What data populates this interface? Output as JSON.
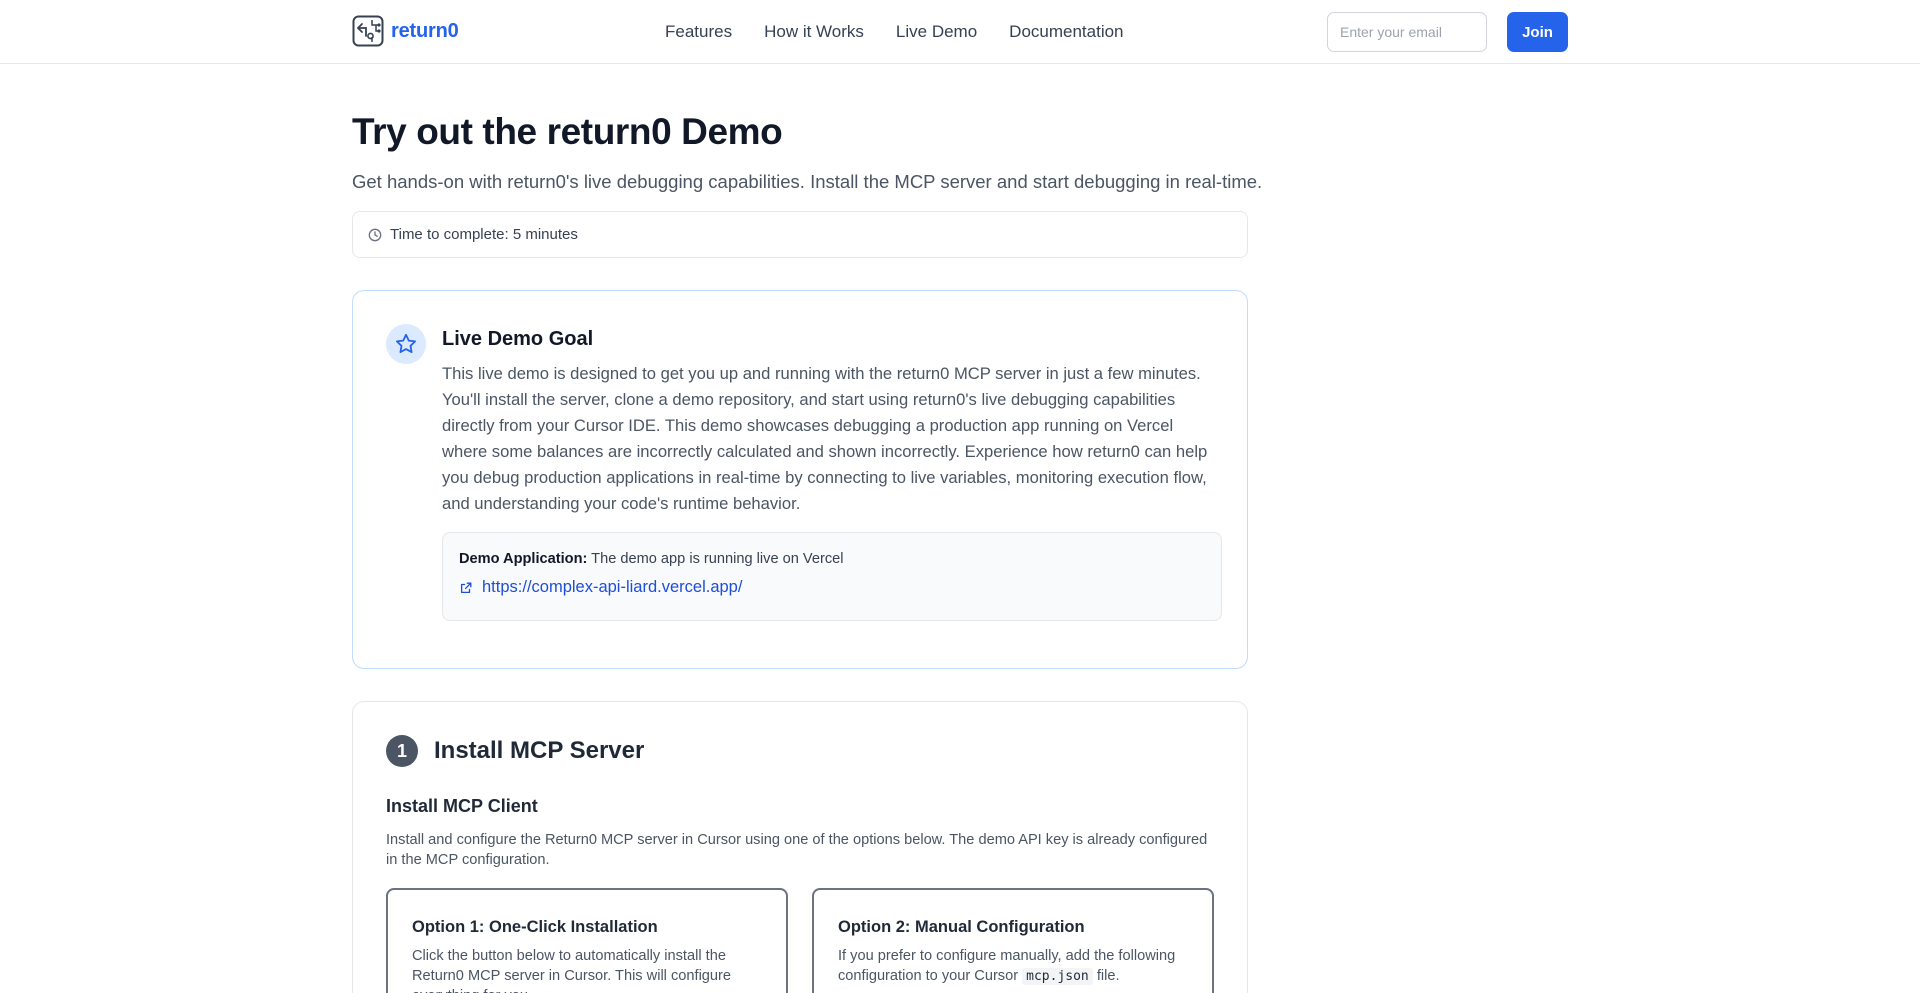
{
  "header": {
    "brand": "return0",
    "nav": [
      "Features",
      "How it Works",
      "Live Demo",
      "Documentation"
    ],
    "email_placeholder": "Enter your email",
    "join_label": "Join",
    "accent_color": "#2563eb"
  },
  "hero": {
    "title": "Try out the return0 Demo",
    "subtitle": "Get hands-on with return0's live debugging capabilities. Install the MCP server and start debugging in real-time.",
    "time_text": "Time to complete: 5 minutes",
    "time_icon": "clock-icon"
  },
  "goal": {
    "icon": "star-icon",
    "title": "Live Demo Goal",
    "description": "This live demo is designed to get you up and running with the return0 MCP server in just a few minutes. You'll install the server, clone a demo repository, and start using return0's live debugging capabilities directly from your Cursor IDE. This demo showcases debugging a production app running on Vercel where some balances are incorrectly calculated and shown incorrectly. Experience how return0 can help you debug production applications in real-time by connecting to live variables, monitoring execution flow, and understanding your code's runtime behavior.",
    "demo_app_label": "Demo Application:",
    "demo_app_text": "The demo app is running live on Vercel",
    "demo_link_icon": "external-link-icon",
    "demo_link": "https://complex-api-liard.vercel.app/"
  },
  "step1": {
    "number": "1",
    "title": "Install MCP Server",
    "subtitle": "Install MCP Client",
    "description": "Install and configure the Return0 MCP server in Cursor using one of the options below. The demo API key is already configured in the MCP configuration.",
    "options": [
      {
        "title": "Option 1: One-Click Installation",
        "description": "Click the button below to automatically install the Return0 MCP server in Cursor. This will configure everything for you."
      },
      {
        "title": "Option 2: Manual Configuration",
        "description_before": "If you prefer to configure manually, add the following configuration to your Cursor",
        "description_code": "mcp.json",
        "description_after": "file."
      }
    ]
  }
}
